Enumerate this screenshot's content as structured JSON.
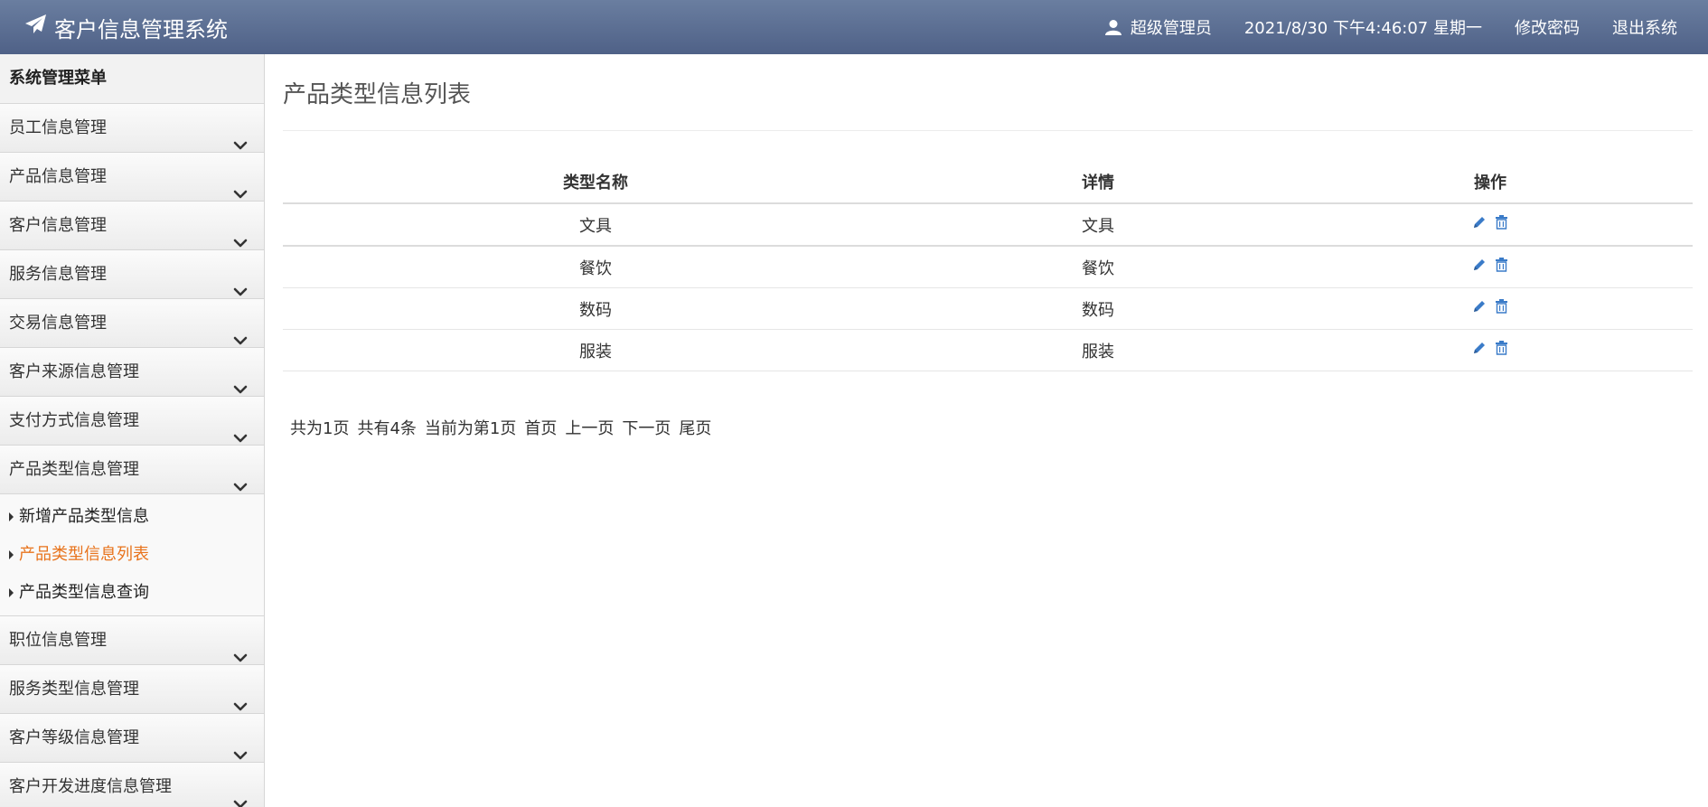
{
  "header": {
    "brand": "客户信息管理系统",
    "user": "超级管理员",
    "datetime": "2021/8/30 下午4:46:07 星期一",
    "change_password": "修改密码",
    "logout": "退出系统"
  },
  "sidebar": {
    "title": "系统管理菜单",
    "items": [
      {
        "label": "员工信息管理"
      },
      {
        "label": "产品信息管理"
      },
      {
        "label": "客户信息管理"
      },
      {
        "label": "服务信息管理"
      },
      {
        "label": "交易信息管理"
      },
      {
        "label": "客户来源信息管理"
      },
      {
        "label": "支付方式信息管理"
      },
      {
        "label": "产品类型信息管理"
      },
      {
        "label": "职位信息管理"
      },
      {
        "label": "服务类型信息管理"
      },
      {
        "label": "客户等级信息管理"
      },
      {
        "label": "客户开发进度信息管理"
      }
    ],
    "expanded_index": 7,
    "submenu": [
      {
        "label": "新增产品类型信息",
        "active": false
      },
      {
        "label": "产品类型信息列表",
        "active": true
      },
      {
        "label": "产品类型信息查询",
        "active": false
      }
    ]
  },
  "main": {
    "title": "产品类型信息列表",
    "table": {
      "headers": [
        "类型名称",
        "详情",
        "操作"
      ],
      "rows": [
        {
          "name": "文具",
          "detail": "文具"
        },
        {
          "name": "餐饮",
          "detail": "餐饮"
        },
        {
          "name": "数码",
          "detail": "数码"
        },
        {
          "name": "服装",
          "detail": "服装"
        }
      ]
    },
    "pager": {
      "total_pages": "共为1页",
      "total_records": "共有4条",
      "current": "当前为第1页",
      "first": "首页",
      "prev": "上一页",
      "next": "下一页",
      "last": "尾页"
    }
  },
  "colors": {
    "header_top": "#6a7ea0",
    "header_bottom": "#4f6187",
    "active_link": "#e8731c",
    "icon_blue": "#3a7bc8"
  },
  "icons": {
    "brand": "paper-plane-icon",
    "user": "user-icon",
    "menu": "chevron-down-icon",
    "sub": "caret-right-icon",
    "edit": "pencil-icon",
    "delete": "trash-icon"
  }
}
